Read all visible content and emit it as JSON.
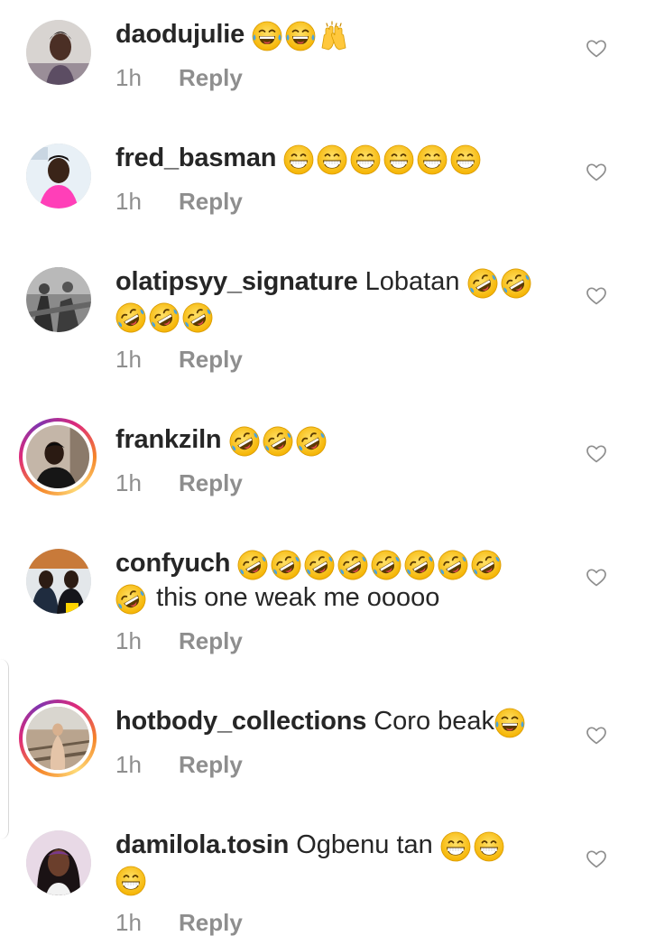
{
  "comments": [
    {
      "username": "daodujulie",
      "text": "",
      "emojis": [
        "laugh",
        "laugh",
        "raised-hands"
      ],
      "time": "1h",
      "reply_label": "Reply",
      "story_ring": false,
      "avatar": "woman-portrait"
    },
    {
      "username": "fred_basman",
      "text": "",
      "emojis": [
        "grin",
        "grin",
        "grin",
        "grin",
        "grin",
        "grin"
      ],
      "time": "1h",
      "reply_label": "Reply",
      "story_ring": false,
      "avatar": "man-pink-shirt"
    },
    {
      "username": "olatipsyy_signature",
      "text": "Lobatan",
      "emojis": [
        "rofl",
        "rofl"
      ],
      "emojis_line2": [
        "rofl",
        "rofl",
        "rofl"
      ],
      "time": "1h",
      "reply_label": "Reply",
      "story_ring": false,
      "avatar": "black-white-photo"
    },
    {
      "username": "frankziln",
      "text": "",
      "emojis": [
        "rofl",
        "rofl",
        "rofl"
      ],
      "time": "1h",
      "reply_label": "Reply",
      "story_ring": true,
      "avatar": "man-dark-portrait"
    },
    {
      "username": "confyuch",
      "text": "",
      "emojis": [
        "rofl",
        "rofl",
        "rofl",
        "rofl",
        "rofl",
        "rofl",
        "rofl",
        "rofl"
      ],
      "line2_text": "this one weak me ooooo",
      "emojis_line2": [
        "rofl"
      ],
      "time": "1h",
      "reply_label": "Reply",
      "story_ring": false,
      "avatar": "two-people"
    },
    {
      "username": "hotbody_collections",
      "text": "Coro beak",
      "emojis": [
        "laugh"
      ],
      "time": "1h",
      "reply_label": "Reply",
      "story_ring": true,
      "avatar": "railway-photo"
    },
    {
      "username": "damilola.tosin",
      "text": "Ogbenu tan",
      "emojis": [
        "grin",
        "grin"
      ],
      "emojis_line2": [
        "grin"
      ],
      "time": "1h",
      "reply_label": "Reply",
      "story_ring": false,
      "avatar": "woman-braids"
    }
  ],
  "icons": {
    "like": "heart-outline-icon"
  },
  "colors": {
    "text": "#262626",
    "meta": "#8e8e8e",
    "heart_stroke": "#8e8e8e",
    "story_ring_start": "#f58529",
    "story_ring_end": "#dd2a7b"
  }
}
